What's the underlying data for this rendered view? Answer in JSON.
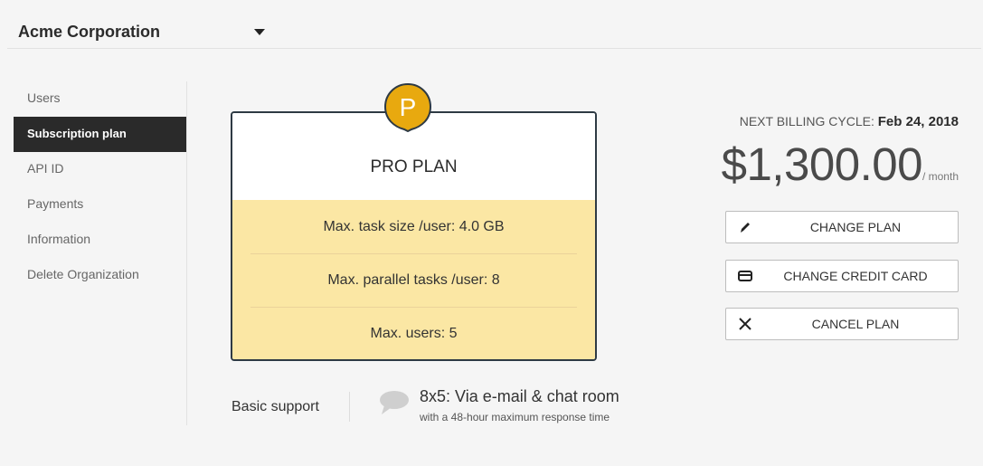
{
  "header": {
    "org_name": "Acme Corporation"
  },
  "sidebar": {
    "items": [
      {
        "label": "Users"
      },
      {
        "label": "Subscription plan",
        "active": true
      },
      {
        "label": "API ID"
      },
      {
        "label": "Payments"
      },
      {
        "label": "Information"
      },
      {
        "label": "Delete Organization"
      }
    ]
  },
  "plan": {
    "badge_letter": "P",
    "name": "PRO PLAN",
    "features": [
      "Max. task size /user: 4.0 GB",
      "Max. parallel tasks /user: 8",
      "Max. users: 5"
    ]
  },
  "support": {
    "label": "Basic support",
    "main": "8x5: Via e-mail & chat room",
    "sub": "with a 48-hour maximum response time"
  },
  "billing": {
    "label": "NEXT BILLING CYCLE:",
    "date": "Feb 24, 2018",
    "amount": "$1,300.00",
    "unit": "/ month"
  },
  "actions": {
    "change_plan": "CHANGE PLAN",
    "change_credit_card": "CHANGE CREDIT CARD",
    "cancel_plan": "CANCEL PLAN"
  },
  "colors": {
    "badge": "#e8a90f",
    "plan_body": "#fbe7a4",
    "sidebar_active": "#2a2a2a"
  }
}
